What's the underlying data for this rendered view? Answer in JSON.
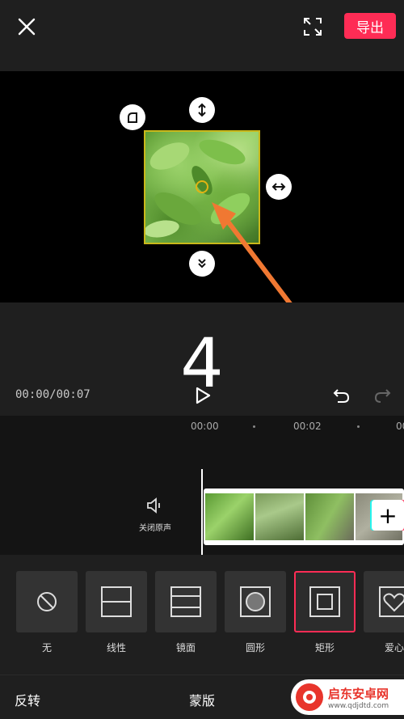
{
  "header": {
    "export_label": "导出",
    "close_icon": "close-icon",
    "fullscreen_icon": "fullscreen-icon"
  },
  "preview": {
    "handle_icons": [
      "rounded-corner-icon",
      "vertical-resize-icon",
      "horizontal-resize-icon",
      "feather-icon"
    ],
    "frame_color": "#c9b81a",
    "marker_color": "#e2b413",
    "annotation_color": "#f07832"
  },
  "controls": {
    "step_number": "4",
    "time": "00:00/00:07"
  },
  "timeline": {
    "ruler": [
      "00:00",
      "00:02",
      "00"
    ],
    "mute_label": "关闭原声",
    "add_label": "+"
  },
  "masks": {
    "items": [
      {
        "label": "无",
        "icon": "none-icon"
      },
      {
        "label": "线性",
        "icon": "linear-mask-icon"
      },
      {
        "label": "镜面",
        "icon": "mirror-mask-icon"
      },
      {
        "label": "圆形",
        "icon": "circle-mask-icon"
      },
      {
        "label": "矩形",
        "icon": "rectangle-mask-icon",
        "selected": true
      },
      {
        "label": "爱心",
        "icon": "heart-mask-icon"
      }
    ]
  },
  "bottom": {
    "invert_label": "反转",
    "title": "蒙版"
  },
  "watermark": {
    "title": "启东安卓网",
    "url": "www.qdjdtd.com"
  },
  "colors": {
    "accent": "#fe2c55",
    "background": "#1f1f1f"
  }
}
